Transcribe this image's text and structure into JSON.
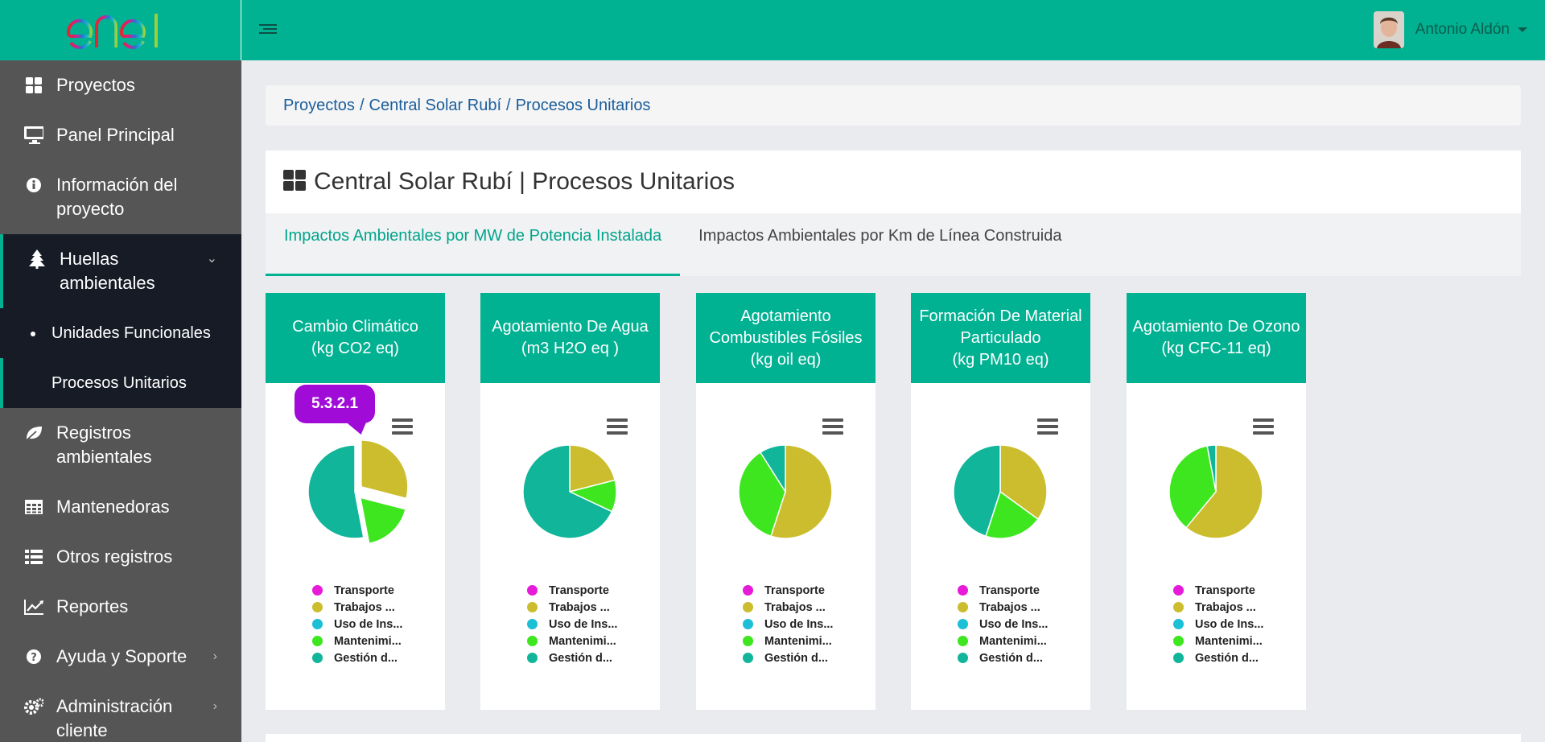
{
  "brand": {
    "logo_text": "enel",
    "accent": "#00b192"
  },
  "sidebar": {
    "items": [
      {
        "label": "Proyectos",
        "icon": "th-large-icon"
      },
      {
        "label": "Panel Principal",
        "icon": "monitor-icon"
      },
      {
        "label": "Información del proyecto",
        "icon": "info-circle-icon"
      },
      {
        "label": "Huellas ambientales",
        "icon": "tree-icon"
      },
      {
        "label": "Registros ambientales",
        "icon": "leaf-icon"
      },
      {
        "label": "Mantenedoras",
        "icon": "table-icon"
      },
      {
        "label": "Otros registros",
        "icon": "list-icon"
      },
      {
        "label": "Reportes",
        "icon": "line-chart-icon"
      },
      {
        "label": "Ayuda y Soporte",
        "icon": "question-circle-icon"
      },
      {
        "label": "Administración cliente",
        "icon": "cogs-icon"
      }
    ],
    "submenu": [
      {
        "label": "Unidades Funcionales"
      },
      {
        "label": "Procesos Unitarios"
      }
    ]
  },
  "topbar": {
    "user_name": "Antonio Aldón"
  },
  "breadcrumb": [
    "Proyectos",
    "Central Solar Rubí",
    "Procesos Unitarios"
  ],
  "page": {
    "title": "Central Solar Rubí | Procesos Unitarios"
  },
  "tabs": [
    {
      "label": "Impactos Ambientales por MW de Potencia Instalada",
      "active": true
    },
    {
      "label": "Impactos Ambientales por Km de Línea Construida",
      "active": false
    }
  ],
  "callout": "5.3.2.1",
  "legend_labels": [
    "Transporte",
    "Trabajos ...",
    "Uso de Ins...",
    "Mantenimi...",
    "Gestión d..."
  ],
  "legend_colors": [
    "#e61ad8",
    "#cbbd2e",
    "#1bbfd6",
    "#3de61e",
    "#10b59a"
  ],
  "chart_data": [
    {
      "type": "pie",
      "title": "Cambio Climático\n(kg CO2 eq)",
      "categories": [
        "Transporte",
        "Trabajos ...",
        "Uso de Ins...",
        "Mantenimi...",
        "Gestión d..."
      ],
      "values": [
        0,
        29,
        0,
        18,
        53
      ],
      "sliced": [
        false,
        true,
        false,
        true,
        false
      ]
    },
    {
      "type": "pie",
      "title": "Agotamiento De Agua\n(m3 H2O eq )",
      "categories": [
        "Transporte",
        "Trabajos ...",
        "Uso de Ins...",
        "Mantenimi...",
        "Gestión d..."
      ],
      "values": [
        0,
        21,
        0,
        11,
        68
      ]
    },
    {
      "type": "pie",
      "title": "Agotamiento\nCombustibles Fósiles\n(kg oil eq)",
      "categories": [
        "Transporte",
        "Trabajos ...",
        "Uso de Ins...",
        "Mantenimi...",
        "Gestión d..."
      ],
      "values": [
        0,
        55,
        0,
        36,
        9
      ]
    },
    {
      "type": "pie",
      "title": "Formación De Material\nParticulado\n(kg PM10 eq)",
      "categories": [
        "Transporte",
        "Trabajos ...",
        "Uso de Ins...",
        "Mantenimi...",
        "Gestión d..."
      ],
      "values": [
        0,
        35,
        0,
        20,
        45
      ]
    },
    {
      "type": "pie",
      "title": "Agotamiento De Ozono\n(kg CFC-11 eq)",
      "categories": [
        "Transporte",
        "Trabajos ...",
        "Uso de Ins...",
        "Mantenimi...",
        "Gestión d..."
      ],
      "values": [
        0,
        61,
        0,
        36,
        3
      ]
    }
  ]
}
